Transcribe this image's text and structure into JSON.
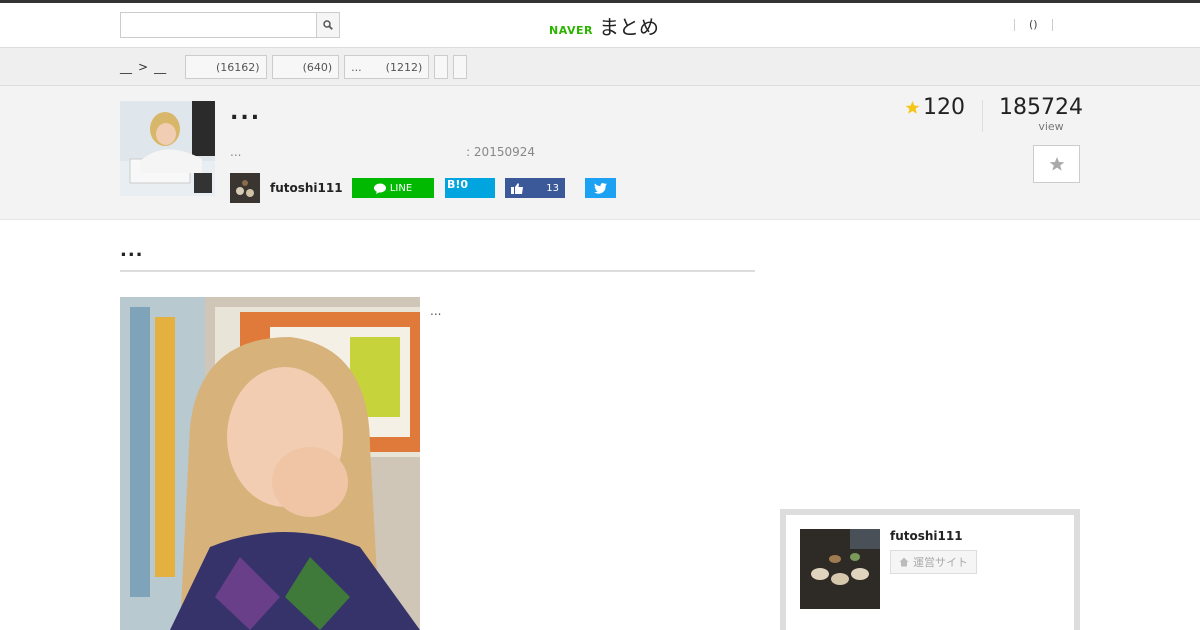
{
  "header": {
    "search_placeholder": "",
    "logo_brand": "NAVER",
    "logo_product": "まとめ",
    "nav_item": "()"
  },
  "breadcrumb": {
    "first": "__",
    "separator": ">",
    "second": "__"
  },
  "tags": [
    {
      "label": "",
      "count": "(16162)"
    },
    {
      "label": "",
      "count": "(640)"
    },
    {
      "label": "...",
      "count": "(1212)"
    },
    {
      "label": "",
      "count": ""
    },
    {
      "label": "",
      "count": ""
    }
  ],
  "article": {
    "title": "...",
    "description": "...",
    "date": ": 20150924",
    "author": "futoshi111",
    "favorites": "120",
    "views": "185724",
    "views_label": "view"
  },
  "share": {
    "line_label": "LINE",
    "hatena_label": "B!0",
    "like_count": "13"
  },
  "content": {
    "section_title": "...",
    "body_text": "..."
  },
  "profile": {
    "name": "futoshi111",
    "site_label": "運営サイト"
  },
  "colors": {
    "naver_green": "#2db400",
    "line_green": "#00b900",
    "hatena_blue": "#00a4de",
    "facebook_blue": "#3b5998",
    "twitter_blue": "#1da1f2",
    "star_gold": "#f5c518"
  }
}
